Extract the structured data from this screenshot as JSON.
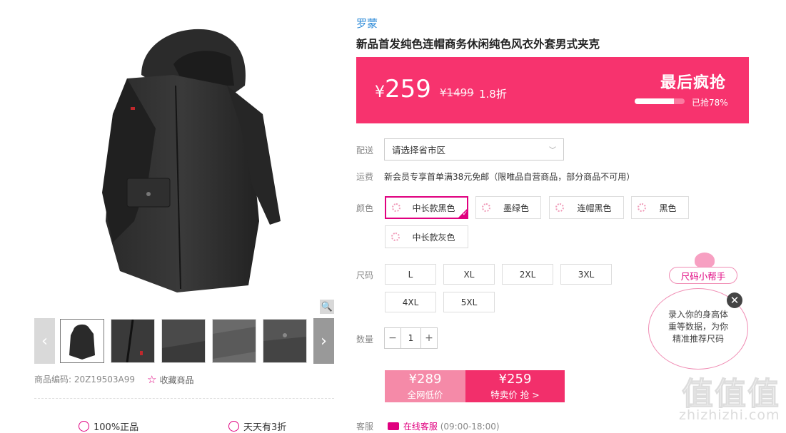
{
  "product": {
    "brand": "罗蒙",
    "title": "新品首发纯色连帽商务休闲纯色风衣外套男式夹克",
    "code_label": "商品编码:",
    "code": "20Z19503A99",
    "favorite_label": "收藏商品"
  },
  "price": {
    "current": "259",
    "currency": "¥",
    "original": "¥1499",
    "discount": "1.8折",
    "promo_label": "最后疯抢",
    "sold_percent": 78,
    "sold_text": "已抢78%"
  },
  "delivery": {
    "label": "配送",
    "placeholder": "请选择省市区"
  },
  "shipping": {
    "label": "运费",
    "text": "新会员专享首单满38元免邮（限唯品自营商品，部分商品不可用）"
  },
  "colors": {
    "label": "颜色",
    "options": [
      "中长款黑色",
      "墨绿色",
      "连帽黑色",
      "黑色",
      "中长款灰色"
    ],
    "selected": 0
  },
  "sizes": {
    "label": "尺码",
    "options": [
      "L",
      "XL",
      "2XL",
      "3XL",
      "4XL",
      "5XL"
    ]
  },
  "quantity": {
    "label": "数量",
    "minus": "−",
    "value": "1",
    "plus": "+"
  },
  "buy": {
    "low_price": "¥289",
    "low_label": "全网低价",
    "special_price": "¥259",
    "special_label": "特卖价 抢 >"
  },
  "service": {
    "label": "客服",
    "link": "在线客服",
    "hours": "(09:00-18:00)"
  },
  "guarantees": [
    "100%正品",
    "天天有3折"
  ],
  "size_helper": {
    "title": "尺码小帮手",
    "text_line1": "录入你的身高体",
    "text_line2": "重等数据，为你",
    "text_line3": "精准推荐尺码",
    "close": "✕"
  },
  "gallery": {
    "zoom_icon": "🔍",
    "prev": "‹",
    "next": "›"
  },
  "watermark": {
    "logo": "值值值",
    "site": "zhizhizhi.com"
  },
  "colors_theme": {
    "accent": "#e0007f",
    "banner": "#f7336e",
    "brand_link": "#2e8bd8"
  }
}
